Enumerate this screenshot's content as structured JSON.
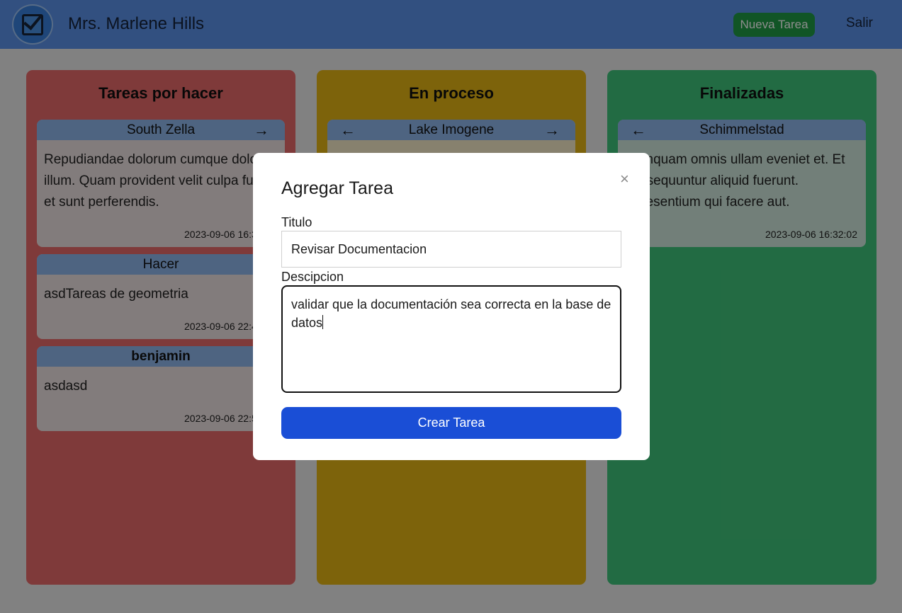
{
  "header": {
    "user_name": "Mrs. Marlene Hills",
    "new_task_label": "Nueva Tarea",
    "exit_label": "Salir",
    "logo_icon": "checkbox-check-icon"
  },
  "columns": [
    {
      "title": "Tareas por hacer",
      "color": "#e86a6a",
      "cards": [
        {
          "title": "South Zella",
          "description": "Repudiandae dolorum cumque dolore illum. Quam provident velit culpa fuga et sunt perferendis.",
          "date": "2023-09-06 16:32:02",
          "arrow_right": "→"
        },
        {
          "title": "Hacer",
          "description": "asdTareas de geometria",
          "date": "2023-09-06 22:45:10",
          "arrow_right": "→"
        },
        {
          "title": "benjamin",
          "description": "asdasd",
          "date": "2023-09-06 22:50:31",
          "arrow_right": "→"
        }
      ]
    },
    {
      "title": "En proceso",
      "color": "#e4b514",
      "cards": [
        {
          "title": "Lake Imogene",
          "description": "",
          "date": "",
          "arrow_left": "←",
          "arrow_right": "→"
        }
      ]
    },
    {
      "title": "Finalizadas",
      "color": "#3fc37a",
      "cards": [
        {
          "title": "Schimmelstad",
          "description": "Cumquam omnis ullam eveniet et. Et consequuntur aliquid fuerunt. Praesentium qui facere aut.",
          "date": "2023-09-06 16:32:02",
          "arrow_left": "←"
        }
      ]
    }
  ],
  "modal": {
    "title": "Agregar Tarea",
    "close_icon": "×",
    "title_label": "Titulo",
    "title_value": "Revisar Documentacion",
    "desc_label": "Descipcion",
    "desc_value": "validar que la documentación sea correcta en la base de datos",
    "submit_label": "Crear Tarea"
  },
  "colors": {
    "navbar": "#5b93e9",
    "new_task_button": "#1f9c45",
    "create_button": "#1a4ed6"
  }
}
